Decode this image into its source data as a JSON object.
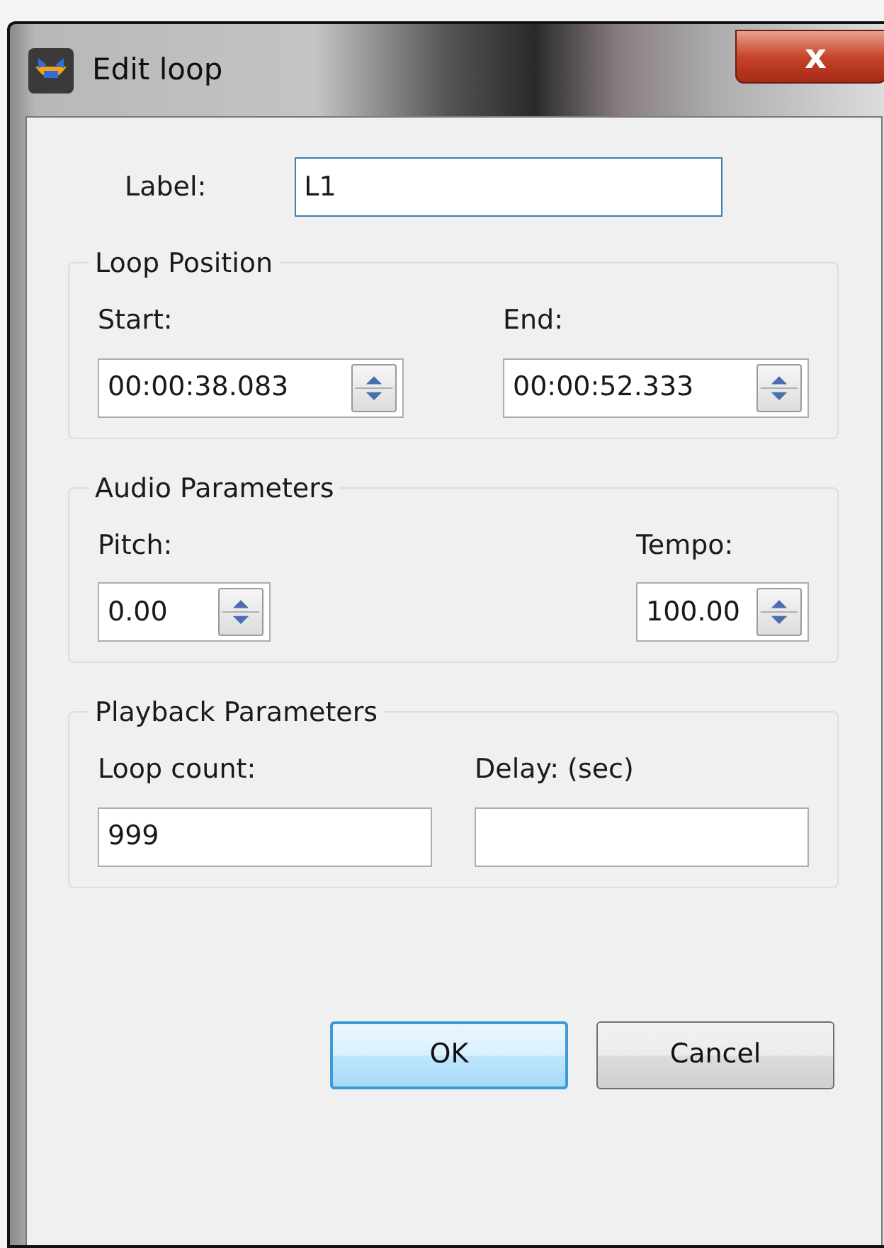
{
  "window": {
    "title": "Edit loop",
    "close": "x"
  },
  "label_field": {
    "label": "Label:",
    "value": "L1",
    "focused": true
  },
  "groups": [
    {
      "title": "Loop Position",
      "fields": [
        {
          "label": "Start:",
          "kind": "spin",
          "value": "00:00:38.083"
        },
        {
          "label": "End:",
          "kind": "spin",
          "value": "00:00:52.333"
        }
      ]
    },
    {
      "title": "Audio Parameters",
      "fields": [
        {
          "label": "Pitch:",
          "kind": "spin",
          "value": "0.00"
        },
        {
          "label": "Tempo:",
          "kind": "spin",
          "value": "100.00"
        }
      ]
    },
    {
      "title": "Playback Parameters",
      "fields": [
        {
          "label": "Loop count:",
          "kind": "text",
          "value": "999"
        },
        {
          "label": "Delay: (sec)",
          "kind": "text"
        }
      ]
    }
  ],
  "buttons": [
    {
      "label": "OK",
      "default": true
    },
    {
      "label": "Cancel",
      "default": false
    }
  ]
}
